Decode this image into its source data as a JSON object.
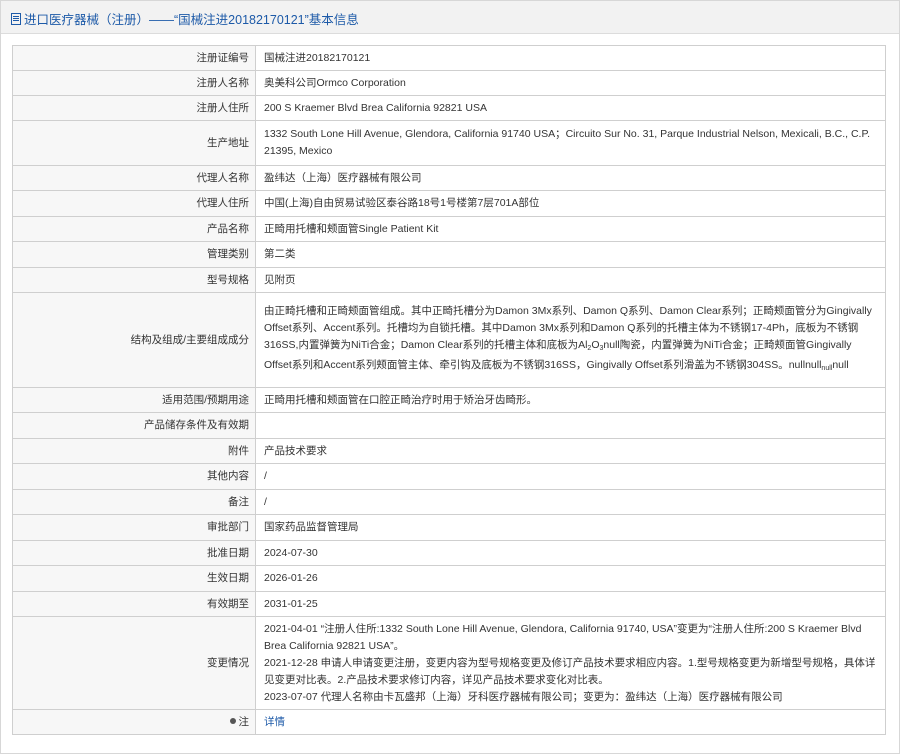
{
  "header": {
    "title": "进口医疗器械（注册）——“国械注进20182170121”基本信息"
  },
  "rows": [
    {
      "label": "注册证编号",
      "value": "国械注进20182170121"
    },
    {
      "label": "注册人名称",
      "value": "奥美科公司Ormco Corporation"
    },
    {
      "label": "注册人住所",
      "value": "200 S Kraemer Blvd Brea California 92821 USA"
    },
    {
      "label": "生产地址",
      "value": "1332 South Lone Hill Avenue, Glendora, California 91740 USA；Circuito Sur No. 31, Parque Industrial Nelson, Mexicali, B.C., C.P. 21395, Mexico"
    },
    {
      "label": "代理人名称",
      "value": "盈纬达（上海）医疗器械有限公司"
    },
    {
      "label": "代理人住所",
      "value": "中国(上海)自由贸易试验区泰谷路18号1号楼第7层701A部位"
    },
    {
      "label": "产品名称",
      "value": "正畸用托槽和颊面管Single Patient Kit"
    },
    {
      "label": "管理类别",
      "value": "第二类"
    },
    {
      "label": "型号规格",
      "value": "见附页"
    },
    {
      "label": "结构及组成/主要组成成分",
      "value_part1": "由正畸托槽和正畸颊面管组成。其中正畸托槽分为Damon 3Mx系列、Damon Q系列、Damon Clear系列；正畸颊面管分为Gingivally Offset系列、Accent系列。托槽均为自锁托槽。其中Damon 3Mx系列和Damon Q系列的托槽主体为不锈钢17-4Ph，底板为不锈钢316SS,内置弹簧为NiTi合金；Damon Clear系列的托槽主体和底板为Al",
      "sub1": "2",
      "value_part2": "O",
      "sub2": "3",
      "value_part3": "null陶瓷，内置弹簧为NiTi合金；正畸颊面管Gingivally Offset系列和Accent系列颊面管主体、牵引钩及底板为不锈钢316SS，Gingivally Offset系列滑盖为不锈钢304SS。nullnull",
      "sub3": "null",
      "value_part4": "null"
    },
    {
      "label": "适用范围/预期用途",
      "value": "正畸用托槽和颊面管在口腔正畸治疗时用于矫治牙齿畸形。"
    },
    {
      "label": "产品储存条件及有效期",
      "value": ""
    },
    {
      "label": "附件",
      "value": "产品技术要求"
    },
    {
      "label": "其他内容",
      "value": "/"
    },
    {
      "label": "备注",
      "value": "/"
    },
    {
      "label": "审批部门",
      "value": "国家药品监督管理局"
    },
    {
      "label": "批准日期",
      "value": "2024-07-30"
    },
    {
      "label": "生效日期",
      "value": "2026-01-26"
    },
    {
      "label": "有效期至",
      "value": "2031-01-25"
    },
    {
      "label": "变更情况",
      "lines": [
        "2021-04-01 “注册人住所:1332 South Lone Hill Avenue, Glendora, California 91740, USA”变更为“注册人住所:200 S Kraemer Blvd Brea California 92821 USA”。",
        "2021-12-28 申请人申请变更注册，变更内容为型号规格变更及修订产品技术要求相应内容。1.型号规格变更为新增型号规格，具体详见变更对比表。2.产品技术要求修订内容，详见产品技术要求变化对比表。",
        "2023-07-07 代理人名称由卡瓦盛邦（上海）牙科医疗器械有限公司；变更为：盈纬达（上海）医疗器械有限公司"
      ]
    },
    {
      "label": "注",
      "value": "详情"
    }
  ]
}
